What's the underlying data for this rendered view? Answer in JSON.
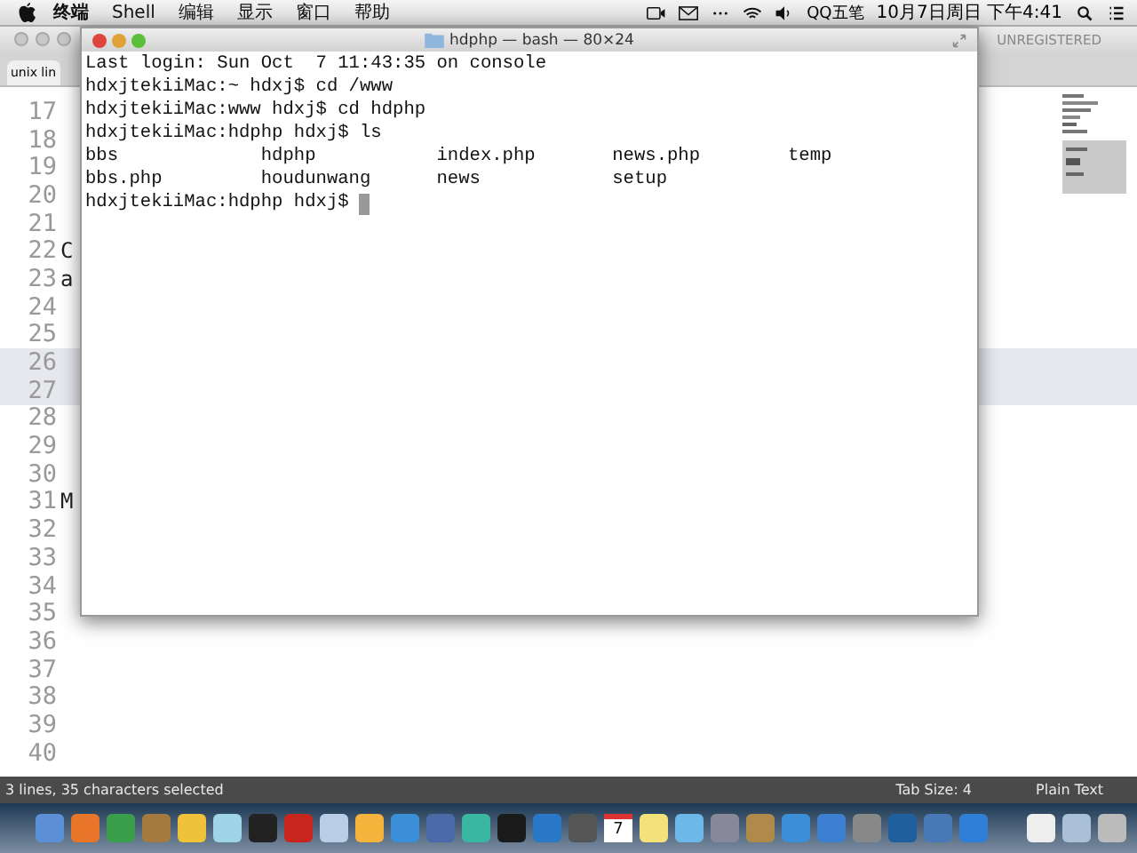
{
  "menu_bar": {
    "items": [
      {
        "label": "终端",
        "bold": true
      },
      {
        "label": "Shell",
        "bold": false
      },
      {
        "label": "编辑",
        "bold": false
      },
      {
        "label": "显示",
        "bold": false
      },
      {
        "label": "窗口",
        "bold": false
      },
      {
        "label": "帮助",
        "bold": false
      }
    ],
    "input_method": "QQ五笔",
    "clock": "10月7日周日 下午4:41"
  },
  "editor": {
    "tab": "unix lin",
    "badge": "UNREGISTERED",
    "lines": [
      {
        "number": "17",
        "selected": false
      },
      {
        "number": "18",
        "selected": false
      },
      {
        "number": "19",
        "selected": false
      },
      {
        "number": "20",
        "selected": false
      },
      {
        "number": "21",
        "selected": false
      },
      {
        "number": "22",
        "text": "C",
        "selected": false
      },
      {
        "number": "23",
        "text": "a",
        "selected": false
      },
      {
        "number": "24",
        "selected": false
      },
      {
        "number": "25",
        "selected": false
      },
      {
        "number": "26",
        "selected": true
      },
      {
        "number": "27",
        "selected": true
      },
      {
        "number": "28",
        "selected": false
      },
      {
        "number": "29",
        "selected": false
      },
      {
        "number": "30",
        "selected": false
      },
      {
        "number": "31",
        "text": "M",
        "selected": false
      },
      {
        "number": "32",
        "selected": false
      },
      {
        "number": "33",
        "selected": false
      },
      {
        "number": "34",
        "selected": false
      },
      {
        "number": "35",
        "selected": false
      },
      {
        "number": "36",
        "selected": false
      },
      {
        "number": "37",
        "selected": false
      },
      {
        "number": "38",
        "selected": false
      },
      {
        "number": "39",
        "selected": false
      },
      {
        "number": "40",
        "selected": false
      }
    ],
    "status_bar": {
      "selection": "3 lines, 35 characters selected",
      "tab_size": "Tab Size: 4",
      "syntax": "Plain Text"
    }
  },
  "terminal": {
    "title": "hdphp — bash — 80×24",
    "cursor_visible": true,
    "lines": [
      "Last login: Sun Oct  7 11:43:35 on console",
      "hdxjtekiiMac:~ hdxj$ cd /www",
      "hdxjtekiiMac:www hdxj$ cd hdphp",
      "hdxjtekiiMac:hdphp hdxj$ ls",
      "bbs             hdphp           index.php       news.php        temp",
      "bbs.php         houdunwang      news            setup",
      "hdxjtekiiMac:hdphp hdxj$ "
    ]
  },
  "dock": {
    "calendar_day": "7"
  }
}
